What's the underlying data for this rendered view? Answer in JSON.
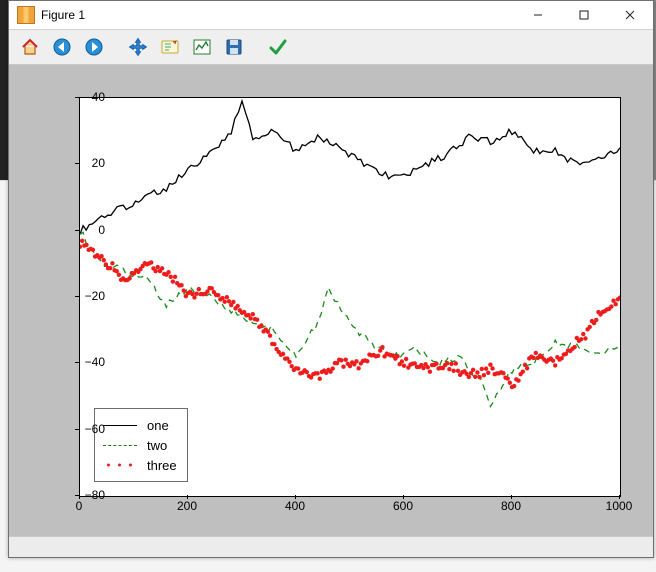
{
  "window": {
    "title": "Figure 1"
  },
  "toolbar": {
    "buttons": [
      {
        "name": "home-icon"
      },
      {
        "name": "back-icon"
      },
      {
        "name": "forward-icon"
      },
      {
        "sep": true
      },
      {
        "name": "pan-icon"
      },
      {
        "name": "zoom-icon"
      },
      {
        "name": "subplots-icon"
      },
      {
        "name": "save-icon"
      },
      {
        "sep": true
      },
      {
        "name": "check-icon"
      }
    ]
  },
  "legend": {
    "one_label": "one",
    "two_label": "two",
    "three_label": "three"
  },
  "chart_data": {
    "type": "line",
    "xlabel": "",
    "ylabel": "",
    "xlim": [
      0,
      1000
    ],
    "ylim": [
      -80,
      40
    ],
    "xticks": [
      0,
      200,
      400,
      600,
      800,
      1000
    ],
    "yticks": [
      -80,
      -60,
      -40,
      -20,
      0,
      20,
      40
    ],
    "series": [
      {
        "name": "one",
        "style": "solid",
        "color": "#000000",
        "x": [
          0,
          40,
          80,
          120,
          160,
          200,
          240,
          280,
          300,
          320,
          360,
          400,
          440,
          480,
          520,
          560,
          600,
          640,
          680,
          720,
          760,
          800,
          840,
          880,
          920,
          960,
          1000
        ],
        "y": [
          0,
          4,
          7,
          10,
          13,
          18,
          23,
          30,
          39,
          28,
          30,
          24,
          28,
          25,
          21,
          17,
          16,
          20,
          23,
          28,
          27,
          30,
          24,
          24,
          20,
          22,
          25
        ]
      },
      {
        "name": "two",
        "style": "dashed",
        "color": "#1a8a1a",
        "x": [
          0,
          40,
          80,
          120,
          160,
          200,
          240,
          280,
          320,
          360,
          400,
          440,
          460,
          500,
          540,
          580,
          620,
          660,
          700,
          740,
          760,
          800,
          840,
          880,
          920,
          960,
          1000
        ],
        "y": [
          0,
          -10,
          -12,
          -14,
          -22,
          -18,
          -20,
          -24,
          -28,
          -30,
          -38,
          -28,
          -18,
          -28,
          -34,
          -38,
          -36,
          -40,
          -38,
          -45,
          -52,
          -42,
          -40,
          -34,
          -35,
          -37,
          -34
        ]
      },
      {
        "name": "three",
        "style": "dots",
        "color": "#ef1c1c",
        "x": [
          0,
          40,
          80,
          120,
          160,
          200,
          240,
          280,
          320,
          360,
          400,
          440,
          480,
          520,
          560,
          600,
          640,
          680,
          720,
          760,
          800,
          840,
          880,
          920,
          960,
          1000
        ],
        "y": [
          -3,
          -8,
          -15,
          -10,
          -12,
          -20,
          -18,
          -22,
          -26,
          -34,
          -42,
          -44,
          -40,
          -40,
          -36,
          -40,
          -42,
          -40,
          -44,
          -42,
          -46,
          -38,
          -40,
          -34,
          -26,
          -20
        ]
      }
    ]
  }
}
